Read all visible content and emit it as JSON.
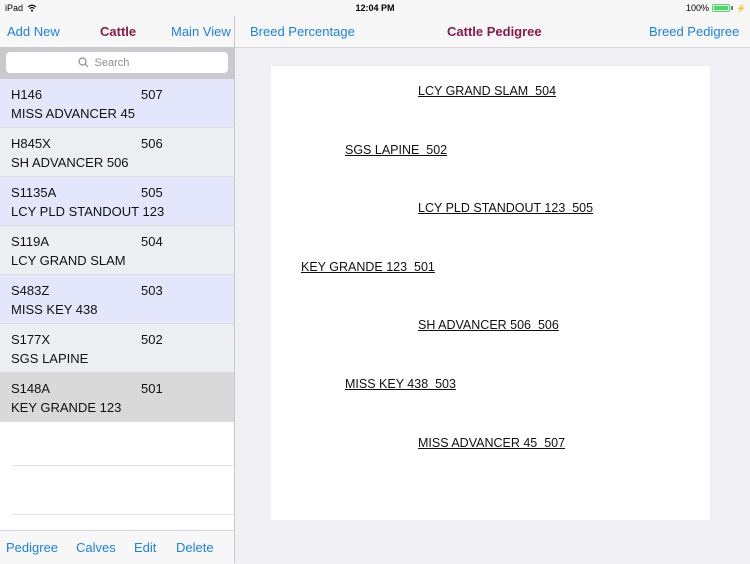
{
  "status_bar": {
    "device": "iPad",
    "time": "12:04 PM",
    "battery_percent_label": "100%",
    "battery_level": 1.0,
    "wifi_icon": "wifi-icon",
    "charging_icon": "bolt-icon"
  },
  "master": {
    "nav": {
      "left_button": "Add New",
      "title": "Cattle",
      "right_button": "Main View"
    },
    "search": {
      "placeholder": "Search",
      "value": ""
    },
    "rows": [
      {
        "tag": "H146",
        "number": "507",
        "name": "MISS ADVANCER 45"
      },
      {
        "tag": "H845X",
        "number": "506",
        "name": "SH ADVANCER 506"
      },
      {
        "tag": "S1135A",
        "number": "505",
        "name": "LCY PLD STANDOUT 123"
      },
      {
        "tag": "S119A",
        "number": "504",
        "name": "LCY GRAND SLAM"
      },
      {
        "tag": "S483Z",
        "number": "503",
        "name": "MISS KEY 438"
      },
      {
        "tag": "S177X",
        "number": "502",
        "name": "SGS LAPINE"
      },
      {
        "tag": "S148A",
        "number": "501",
        "name": "KEY GRANDE 123"
      }
    ],
    "selected_index": 6,
    "toolbar": {
      "pedigree": "Pedigree",
      "calves": "Calves",
      "edit": "Edit",
      "delete": "Delete"
    }
  },
  "detail": {
    "nav": {
      "left_button": "Breed Percentage",
      "title": "Cattle Pedigree",
      "right_button": "Breed Pedigree"
    },
    "pedigree": {
      "sire_sire": "LCY GRAND SLAM  504",
      "sire": "SGS LAPINE  502",
      "sire_dam": "LCY PLD STANDOUT 123  505",
      "subject": "KEY GRANDE 123  501",
      "dam_sire": "SH ADVANCER 506  506",
      "dam": "MISS KEY 438  503",
      "dam_dam": "MISS ADVANCER 45  507"
    }
  },
  "colors": {
    "accent": "#1a82e6",
    "title": "#8b1a4a",
    "row_alt_blue": "#e4e7fb",
    "row_alt_gray": "#eceef2",
    "row_selected": "#d9d9d9",
    "battery": "#4cd964"
  }
}
